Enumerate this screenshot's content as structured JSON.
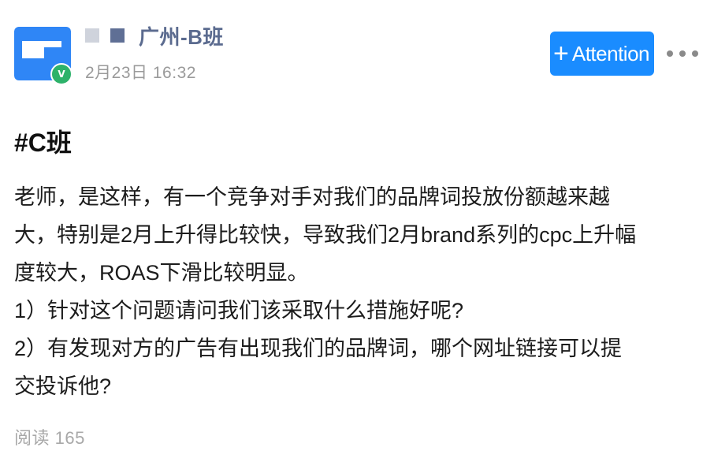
{
  "author": {
    "name": "广州-B班",
    "time": "2月23日 16:32",
    "verified_badge": "V"
  },
  "header": {
    "follow_button": {
      "icon": "+",
      "label": "Attention"
    },
    "more_icon": "more-horizontal-icon"
  },
  "post": {
    "topic": "#C班",
    "lines": [
      "老师，是这样，有一个竞争对手对我们的品牌词投放份额越来越",
      "大，特别是2月上升得比较快，导致我们2月brand系列的cpc上升幅",
      "度较大，ROAS下滑比较明显。",
      "1）针对这个问题请问我们该采取什么措施好呢?",
      "2）有发现对方的广告有出现我们的品牌词，哪个网址链接可以提",
      "交投诉他?"
    ]
  },
  "footer": {
    "read_count": "阅读 165"
  },
  "colors": {
    "accent": "#1a8cff",
    "author_name": "#5b6b8f",
    "verified": "#2db26a",
    "muted_text": "#9a9a9a"
  }
}
